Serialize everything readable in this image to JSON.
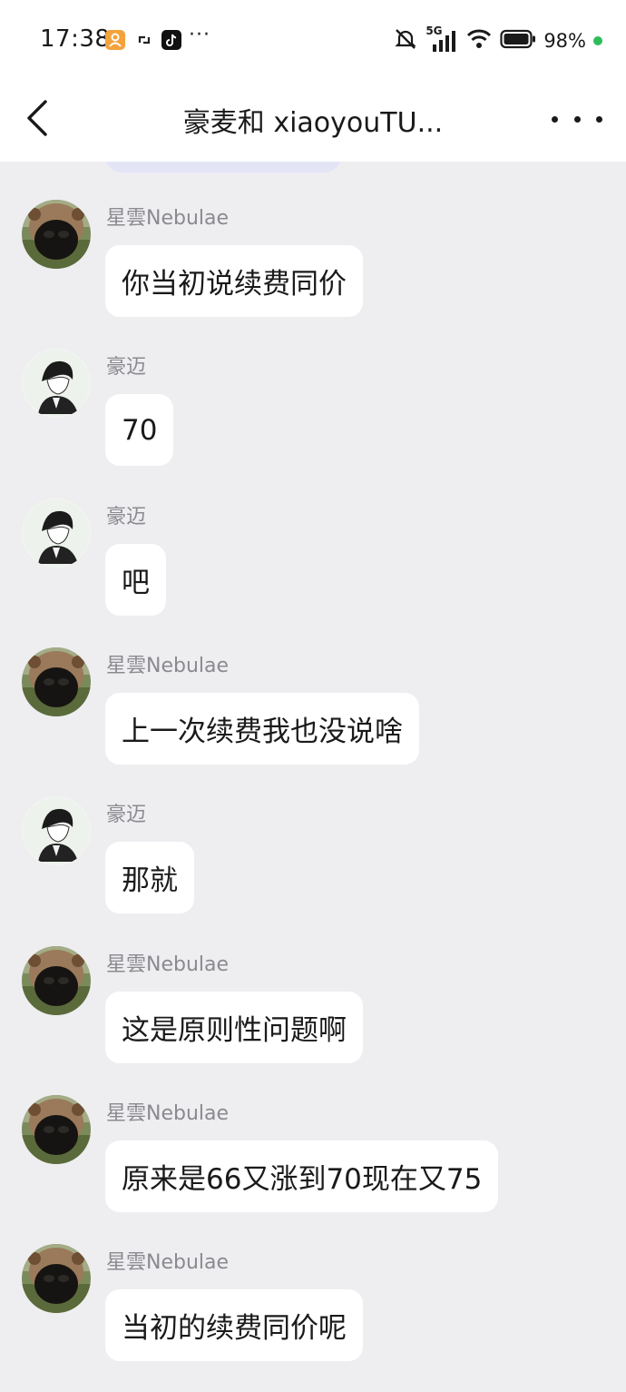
{
  "status_bar": {
    "time": "17:38",
    "network": "5G",
    "battery": "98%",
    "icons": [
      "app-notification-icon",
      "sync-icon",
      "tiktok-icon",
      "more-notifications-icon",
      "mute-icon",
      "signal-icon",
      "wifi-icon",
      "battery-icon"
    ]
  },
  "header": {
    "title": "豪麦和 xiaoyouTU...",
    "back_icon": "chevron-left-icon",
    "more_icon": "more-horizontal-icon"
  },
  "messages": [
    {
      "sender": "星雲Nebulae",
      "text": "你当初说续费同价",
      "avatar": "capybara"
    },
    {
      "sender": "豪迈",
      "text": "70",
      "avatar": "sketch"
    },
    {
      "sender": "豪迈",
      "text": "吧",
      "avatar": "sketch"
    },
    {
      "sender": "星雲Nebulae",
      "text": "上一次续费我也没说啥",
      "avatar": "capybara"
    },
    {
      "sender": "豪迈",
      "text": "那就",
      "avatar": "sketch"
    },
    {
      "sender": "星雲Nebulae",
      "text": "这是原则性问题啊",
      "avatar": "capybara"
    },
    {
      "sender": "星雲Nebulae",
      "text": "原来是66又涨到70现在又75",
      "avatar": "capybara"
    },
    {
      "sender": "星雲Nebulae",
      "text": "当初的续费同价呢",
      "avatar": "capybara"
    }
  ],
  "colors": {
    "background": "#eeeef1",
    "bubble": "#ffffff",
    "sender_name": "#8a8a8f",
    "battery_dot": "#2ebc5b"
  }
}
